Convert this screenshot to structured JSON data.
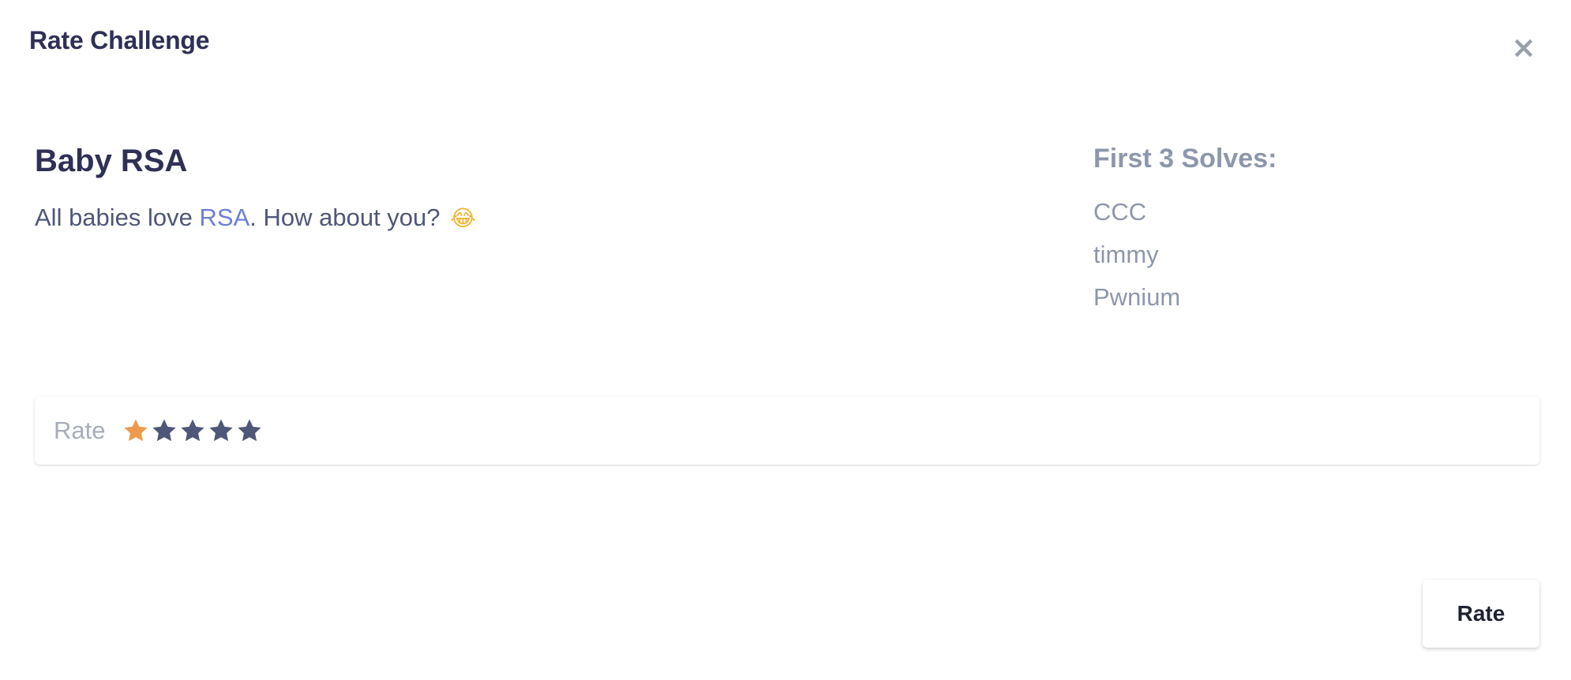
{
  "modal": {
    "title": "Rate Challenge",
    "close_label": "×"
  },
  "challenge": {
    "name": "Baby RSA",
    "description_prefix": "All babies love ",
    "description_link": "RSA",
    "description_suffix": ". How about you?",
    "emoji": "😂"
  },
  "solves": {
    "title": "First 3 Solves:",
    "items": [
      "CCC",
      "timmy",
      "Pwnium"
    ]
  },
  "rating": {
    "label": "Rate",
    "value": 1,
    "max": 5,
    "active_color": "#ee9a4d",
    "inactive_color": "#4e5777"
  },
  "submit": {
    "label": "Rate"
  }
}
